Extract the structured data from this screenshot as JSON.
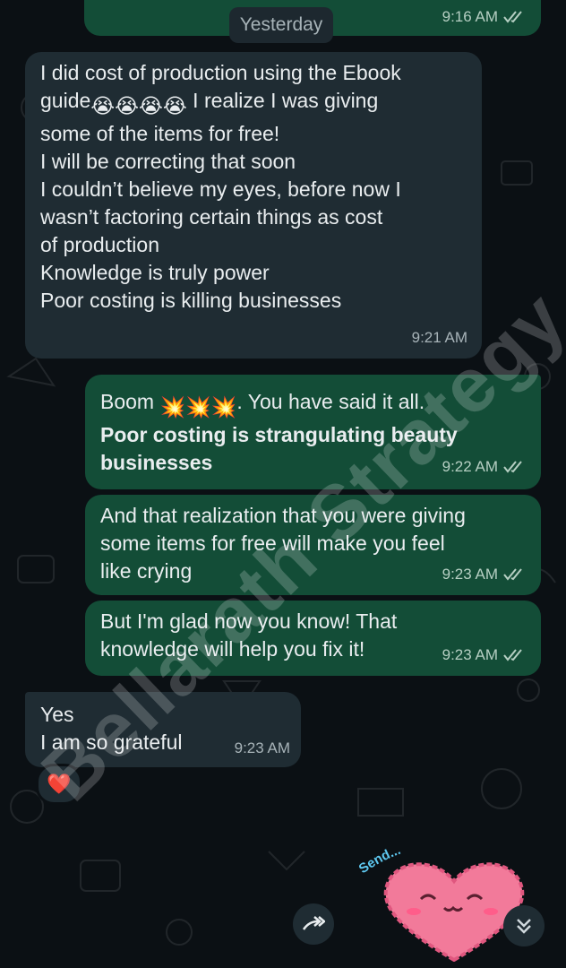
{
  "date_chip": "Yesterday",
  "messages": {
    "m0": {
      "time": "9:16 AM"
    },
    "m1": {
      "line1": "I did cost of production using the Ebook",
      "guide_word": "guide",
      "emojis": "😭😭😭😭",
      "line2_rest": " I realize I was giving",
      "rest": "some of the items  for free!\nI will be correcting that soon\nI couldn’t believe my eyes, before now I\nwasn’t factoring certain things as cost\nof production\nKnowledge is truly power\nPoor costing is killing businesses",
      "time": "9:21 AM"
    },
    "m2": {
      "prefix": "Boom ",
      "emojis": "💥💥💥",
      "suffix": ". You have said it all.",
      "bold": "Poor costing is strangulating beauty\nbusinesses",
      "time": "9:22 AM"
    },
    "m3": {
      "text": "And that realization that you were giving\nsome items for free will make you feel\nlike crying",
      "time": "9:23 AM"
    },
    "m4": {
      "text": "But I'm glad now you know! That\nknowledge will help you fix it!",
      "time": "9:23 AM"
    },
    "m5": {
      "text": "Yes\nI am so grateful",
      "time": "9:23 AM",
      "reaction": "❤️"
    }
  },
  "sticker": {
    "caption": "Send..."
  },
  "watermark": "Bellarath Strategy",
  "colors": {
    "background": "#0b1014",
    "incoming_bubble": "#1f2c33",
    "outgoing_bubble": "#134d37",
    "read_ticks": "#b6cfc3"
  },
  "icons": [
    "double-check-icon",
    "forward-icon",
    "scroll-down-icon",
    "heart-icon"
  ]
}
